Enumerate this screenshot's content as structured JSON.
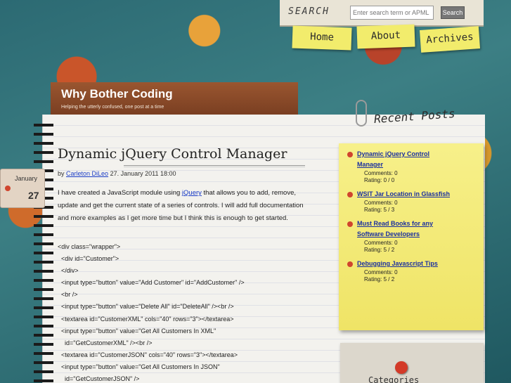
{
  "header": {
    "search_label": "SEARCH",
    "search_placeholder": "Enter search term or APML url",
    "search_button": "Search",
    "nav": [
      "Home",
      "About",
      "Archives"
    ]
  },
  "site": {
    "title": "Why Bother Coding",
    "tagline": "Helping the utterly confused, one post at a time"
  },
  "date_badge": {
    "month": "January",
    "day": "27"
  },
  "post": {
    "title": "Dynamic jQuery Control Manager",
    "meta_by": "by",
    "author": "Carleton DiLeo",
    "date": "27. January 2011 18:00",
    "body_before_link": "I have created a JavaScript module using ",
    "body_link": "jQuery",
    "body_after_link": " that allows you to add, remove, update and get the current state of a series of controls. I will add full documentation and more examples as I get more time but I think this is enough to get started.",
    "code_lines": [
      "<div class=\"wrapper\">",
      "  <div id=\"Customer\">",
      "  </div>",
      "  <input type=\"button\" value=\"Add Customer\" id=\"AddCustomer\" />",
      "  <br />",
      "  <input type=\"button\" value=\"Delete All\" id=\"DeleteAll\" /><br />",
      "  <textarea id=\"CustomerXML\" cols=\"40\" rows=\"3\"></textarea>",
      "  <input type=\"button\" value=\"Get All Customers In XML\"",
      "    id=\"GetCustomerXML\" /><br />",
      "  <textarea id=\"CustomerJSON\" cols=\"40\" rows=\"3\"></textarea>",
      "  <input type=\"button\" value=\"Get All Customers In JSON\"",
      "    id=\"GetCustomerJSON\" />"
    ]
  },
  "sidebar": {
    "recent_title": "Recent Posts",
    "recent_posts": [
      {
        "title_line1": "Dynamic jQuery Control",
        "title_line2": "Manager",
        "comments": "Comments: 0",
        "rating": "Rating: 0 / 0"
      },
      {
        "title_line1": "WSIT Jar Location in Glassfish",
        "title_line2": "",
        "comments": "Comments: 0",
        "rating": "Rating: 5 / 3"
      },
      {
        "title_line1": "Must Read Books for any",
        "title_line2": "Software Developers",
        "comments": "Comments: 0",
        "rating": "Rating: 5 / 2"
      },
      {
        "title_line1": "Debugging Javascript Tips",
        "title_line2": "",
        "comments": "Comments: 0",
        "rating": "Rating: 5 / 2"
      }
    ],
    "categories_title": "Categories"
  }
}
